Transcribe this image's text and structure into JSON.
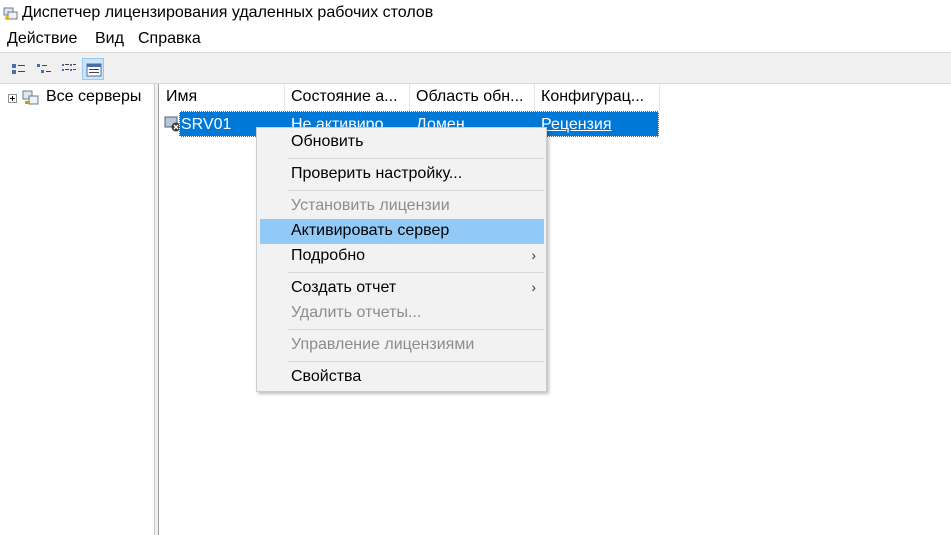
{
  "window": {
    "title": "Диспетчер лицензирования удаленных рабочих столов"
  },
  "menubar": {
    "items": [
      "Действие",
      "Вид",
      "Справка"
    ]
  },
  "toolbar": {
    "buttons": [
      "large-icons-view",
      "small-icons-view",
      "list-view",
      "details-view"
    ],
    "active": "details-view"
  },
  "tree": {
    "root_label": "Все серверы"
  },
  "list": {
    "columns": [
      "Имя",
      "Состояние а...",
      "Область обн...",
      "Конфигурац..."
    ],
    "rows": [
      {
        "name": "SRV01",
        "state": "Не активиро...",
        "scope": "Домен",
        "config": "Рецензия",
        "selected": true
      }
    ]
  },
  "context_menu": {
    "items": [
      {
        "label": "Обновить",
        "enabled": true
      },
      {
        "label": "Проверить настройку...",
        "enabled": true
      },
      {
        "label": "Установить лицензии",
        "enabled": false
      },
      {
        "label": "Активировать сервер",
        "enabled": true,
        "highlighted": true
      },
      {
        "label": "Подробно",
        "enabled": true,
        "submenu": true
      },
      {
        "label": "Создать отчет",
        "enabled": true,
        "submenu": true
      },
      {
        "label": "Удалить отчеты...",
        "enabled": false
      },
      {
        "label": "Управление лицензиями",
        "enabled": false
      },
      {
        "label": "Свойства",
        "enabled": true
      }
    ]
  },
  "colors": {
    "selection": "#0078d7",
    "menu_highlight": "#91c9f7",
    "disabled_text": "#8c8c8c"
  }
}
